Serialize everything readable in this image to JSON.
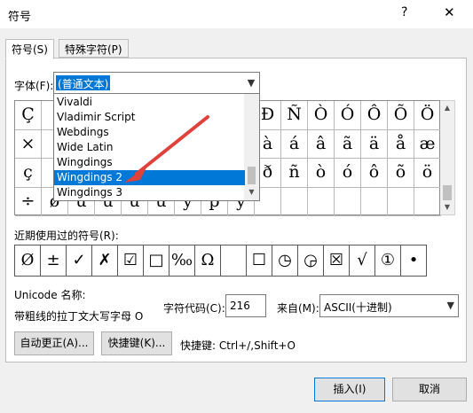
{
  "window": {
    "title": "符号",
    "help_glyph": "?",
    "close_glyph": "✕"
  },
  "tabs": [
    {
      "label": "符号(S)"
    },
    {
      "label": "特殊字符(P)"
    }
  ],
  "font": {
    "label": "字体(F):",
    "value": "(普通文本)",
    "options": [
      "Vivaldi",
      "Vladimir Script",
      "Webdings",
      "Wide Latin",
      "Wingdings",
      "Wingdings 2",
      "Wingdings 3"
    ],
    "selected": "Wingdings 2"
  },
  "symbol_grid": {
    "rows": [
      [
        "Ç",
        "",
        "",
        "",
        "",
        "",
        "",
        "",
        "",
        "Ð",
        "Ñ",
        "Ò",
        "Ó",
        "Ô",
        "Õ"
      ],
      [
        "×",
        "",
        "",
        "",
        "",
        "",
        "",
        "",
        "",
        "à",
        "á",
        "â",
        "ã",
        "ä",
        "å"
      ],
      [
        "ç",
        "",
        "",
        "",
        "",
        "",
        "",
        "",
        "",
        "ð",
        "ñ",
        "ò",
        "ó",
        "ô",
        "õ"
      ],
      [
        "÷",
        "ø",
        "ù",
        "ú",
        "û",
        "ü",
        "ý",
        "þ",
        "ÿ",
        "",
        "",
        "",
        "",
        "",
        ""
      ]
    ],
    "last_col": [
      "Ö",
      "æ",
      "ö",
      ""
    ]
  },
  "recent": {
    "label": "近期使用过的符号(R):",
    "symbols": [
      "Ø",
      "±",
      "✓",
      "✗",
      "☑",
      "□",
      "‰",
      "Ω",
      "",
      "☐",
      "◷",
      "◶",
      "☒",
      "√",
      "①",
      "•"
    ]
  },
  "unicode": {
    "label": "Unicode 名称:",
    "name": "带粗线的拉丁文大写字母 O",
    "char_code_label": "字符代码(C):",
    "char_code": "216",
    "from_label": "来自(M):",
    "from_value": "ASCII(十进制)"
  },
  "buttons": {
    "autocorrect": "自动更正(A)...",
    "shortcut_key": "快捷键(K)...",
    "shortcut_text": "快捷键: Ctrl+/,Shift+O",
    "insert": "插入(I)",
    "cancel": "取消"
  },
  "colors": {
    "accent": "#0078d7",
    "annotation": "#e0413a"
  }
}
